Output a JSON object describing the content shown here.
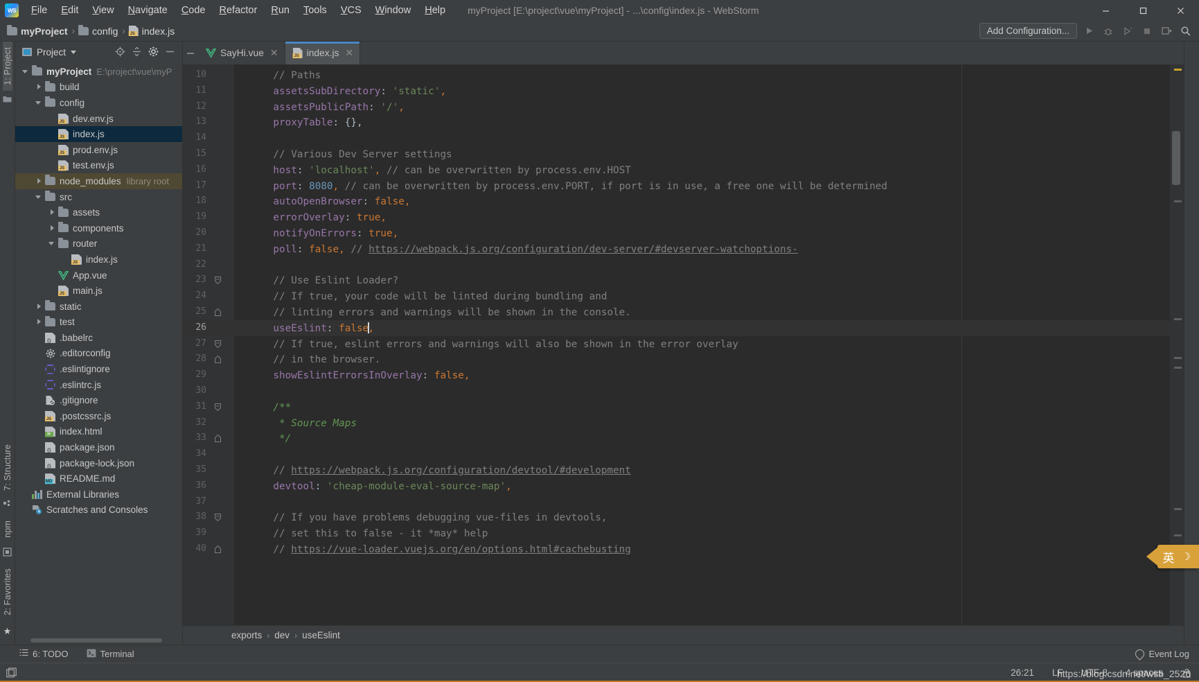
{
  "window": {
    "title": "myProject [E:\\project\\vue\\myProject] - ...\\config\\index.js - WebStorm",
    "minimize": "—",
    "maximize": "☐",
    "close": "✕"
  },
  "menu": {
    "items": [
      "File",
      "Edit",
      "View",
      "Navigate",
      "Code",
      "Refactor",
      "Run",
      "Tools",
      "VCS",
      "Window",
      "Help"
    ]
  },
  "navbar": {
    "breadcrumb": [
      {
        "label": "myProject",
        "icon": "folder-icon",
        "bold": true
      },
      {
        "label": "config",
        "icon": "folder-icon",
        "bold": false
      },
      {
        "label": "index.js",
        "icon": "js-file-icon",
        "bold": false
      }
    ],
    "add_configuration": "Add Configuration...",
    "icons": [
      "run-icon",
      "debug-icon",
      "coverage-icon",
      "stop-icon",
      "search-everywhere-icon",
      "magnifier-icon"
    ]
  },
  "left_strip": {
    "top_label": "1: Project",
    "labels": [
      "7: Structure",
      "npm",
      "2: Favorites"
    ]
  },
  "project_panel": {
    "title": "Project",
    "actions": [
      "locate-icon",
      "collapse-all-icon",
      "gear-icon",
      "hide-icon"
    ],
    "tree": [
      {
        "depth": 0,
        "arrow": "down",
        "icon": "folder",
        "label": "myProject",
        "bold": true,
        "muted": "E:\\project\\vue\\myP"
      },
      {
        "depth": 1,
        "arrow": "right",
        "icon": "folder",
        "label": "build"
      },
      {
        "depth": 1,
        "arrow": "down",
        "icon": "folder",
        "label": "config"
      },
      {
        "depth": 2,
        "arrow": "none",
        "icon": "js",
        "label": "dev.env.js"
      },
      {
        "depth": 2,
        "arrow": "none",
        "icon": "js",
        "label": "index.js",
        "selected": true
      },
      {
        "depth": 2,
        "arrow": "none",
        "icon": "js",
        "label": "prod.env.js"
      },
      {
        "depth": 2,
        "arrow": "none",
        "icon": "js",
        "label": "test.env.js"
      },
      {
        "depth": 1,
        "arrow": "right",
        "icon": "folder",
        "label": "node_modules",
        "libtag": "library root",
        "libroot": true
      },
      {
        "depth": 1,
        "arrow": "down",
        "icon": "folder",
        "label": "src"
      },
      {
        "depth": 2,
        "arrow": "right",
        "icon": "folder",
        "label": "assets"
      },
      {
        "depth": 2,
        "arrow": "right",
        "icon": "folder",
        "label": "components"
      },
      {
        "depth": 2,
        "arrow": "down",
        "icon": "folder",
        "label": "router"
      },
      {
        "depth": 3,
        "arrow": "none",
        "icon": "js",
        "label": "index.js"
      },
      {
        "depth": 2,
        "arrow": "none",
        "icon": "vue",
        "label": "App.vue"
      },
      {
        "depth": 2,
        "arrow": "none",
        "icon": "js",
        "label": "main.js"
      },
      {
        "depth": 1,
        "arrow": "right",
        "icon": "folder",
        "label": "static"
      },
      {
        "depth": 1,
        "arrow": "right",
        "icon": "folder",
        "label": "test"
      },
      {
        "depth": 1,
        "arrow": "none",
        "icon": "babel",
        "label": ".babelrc"
      },
      {
        "depth": 1,
        "arrow": "none",
        "icon": "gear",
        "label": ".editorconfig"
      },
      {
        "depth": 1,
        "arrow": "none",
        "icon": "eslint",
        "label": ".eslintignore"
      },
      {
        "depth": 1,
        "arrow": "none",
        "icon": "eslint",
        "label": ".eslintrc.js"
      },
      {
        "depth": 1,
        "arrow": "none",
        "icon": "gitignore",
        "label": ".gitignore"
      },
      {
        "depth": 1,
        "arrow": "none",
        "icon": "js",
        "label": ".postcssrc.js"
      },
      {
        "depth": 1,
        "arrow": "none",
        "icon": "html",
        "label": "index.html"
      },
      {
        "depth": 1,
        "arrow": "none",
        "icon": "json",
        "label": "package.json"
      },
      {
        "depth": 1,
        "arrow": "none",
        "icon": "json",
        "label": "package-lock.json"
      },
      {
        "depth": 1,
        "arrow": "none",
        "icon": "md",
        "label": "README.md"
      },
      {
        "depth": 0,
        "arrow": "none",
        "icon": "libs",
        "label": "External Libraries"
      },
      {
        "depth": 0,
        "arrow": "none",
        "icon": "scratch",
        "label": "Scratches and Consoles"
      }
    ]
  },
  "editor": {
    "tabs": [
      {
        "label": "SayHi.vue",
        "icon": "vue-file-icon",
        "active": false
      },
      {
        "label": "index.js",
        "icon": "js-file-icon",
        "active": true
      }
    ],
    "first_line": 10,
    "current_line": 26,
    "lines": [
      {
        "n": 10,
        "fold": "",
        "tokens": [
          {
            "t": "    // Paths",
            "c": "c-comment"
          }
        ]
      },
      {
        "n": 11,
        "fold": "",
        "tokens": [
          {
            "t": "    assetsSubDirectory",
            "c": "c-key"
          },
          {
            "t": ": ",
            "c": "c-punc"
          },
          {
            "t": "'static'",
            "c": "c-str"
          },
          {
            "t": ",",
            "c": "c-comma"
          }
        ]
      },
      {
        "n": 12,
        "fold": "",
        "tokens": [
          {
            "t": "    assetsPublicPath",
            "c": "c-key"
          },
          {
            "t": ": ",
            "c": "c-punc"
          },
          {
            "t": "'/'",
            "c": "c-str"
          },
          {
            "t": ",",
            "c": "c-comma"
          }
        ]
      },
      {
        "n": 13,
        "fold": "",
        "tokens": [
          {
            "t": "    proxyTable",
            "c": "c-key"
          },
          {
            "t": ": {},",
            "c": "c-punc"
          }
        ]
      },
      {
        "n": 14,
        "fold": "",
        "tokens": []
      },
      {
        "n": 15,
        "fold": "",
        "tokens": [
          {
            "t": "    // Various Dev Server settings",
            "c": "c-comment"
          }
        ]
      },
      {
        "n": 16,
        "fold": "",
        "tokens": [
          {
            "t": "    host",
            "c": "c-key"
          },
          {
            "t": ": ",
            "c": "c-punc"
          },
          {
            "t": "'localhost'",
            "c": "c-str"
          },
          {
            "t": ",",
            "c": "c-comma"
          },
          {
            "t": " // can be overwritten by process.env.HOST",
            "c": "c-comment"
          }
        ]
      },
      {
        "n": 17,
        "fold": "",
        "tokens": [
          {
            "t": "    port",
            "c": "c-key"
          },
          {
            "t": ": ",
            "c": "c-punc"
          },
          {
            "t": "8080",
            "c": "c-num"
          },
          {
            "t": ",",
            "c": "c-comma"
          },
          {
            "t": " // can be overwritten by process.env.PORT, if port is in use, a free one will be determined",
            "c": "c-comment"
          }
        ]
      },
      {
        "n": 18,
        "fold": "",
        "tokens": [
          {
            "t": "    autoOpenBrowser",
            "c": "c-key"
          },
          {
            "t": ": ",
            "c": "c-punc"
          },
          {
            "t": "false",
            "c": "c-kw"
          },
          {
            "t": ",",
            "c": "c-comma"
          }
        ]
      },
      {
        "n": 19,
        "fold": "",
        "tokens": [
          {
            "t": "    errorOverlay",
            "c": "c-key"
          },
          {
            "t": ": ",
            "c": "c-punc"
          },
          {
            "t": "true",
            "c": "c-kw"
          },
          {
            "t": ",",
            "c": "c-comma"
          }
        ]
      },
      {
        "n": 20,
        "fold": "",
        "tokens": [
          {
            "t": "    notifyOnErrors",
            "c": "c-key"
          },
          {
            "t": ": ",
            "c": "c-punc"
          },
          {
            "t": "true",
            "c": "c-kw"
          },
          {
            "t": ",",
            "c": "c-comma"
          }
        ]
      },
      {
        "n": 21,
        "fold": "",
        "tokens": [
          {
            "t": "    poll",
            "c": "c-key"
          },
          {
            "t": ": ",
            "c": "c-punc"
          },
          {
            "t": "false",
            "c": "c-kw"
          },
          {
            "t": ",",
            "c": "c-comma"
          },
          {
            "t": " // ",
            "c": "c-comment"
          },
          {
            "t": "https://webpack.js.org/configuration/dev-server/#devserver-watchoptions-",
            "c": "c-link"
          }
        ]
      },
      {
        "n": 22,
        "fold": "",
        "tokens": []
      },
      {
        "n": 23,
        "fold": "start",
        "tokens": [
          {
            "t": "    // Use Eslint Loader?",
            "c": "c-comment"
          }
        ]
      },
      {
        "n": 24,
        "fold": "",
        "tokens": [
          {
            "t": "    // If true, your code will be linted during bundling and",
            "c": "c-comment"
          }
        ]
      },
      {
        "n": 25,
        "fold": "end",
        "tokens": [
          {
            "t": "    // linting errors and warnings will be shown in the console.",
            "c": "c-comment"
          }
        ]
      },
      {
        "n": 26,
        "fold": "",
        "current": true,
        "tokens": [
          {
            "t": "    useEslint",
            "c": "c-key"
          },
          {
            "t": ": ",
            "c": "c-punc"
          },
          {
            "t": "false",
            "c": "c-kw"
          },
          {
            "t": "|",
            "c": "caret"
          },
          {
            "t": ",",
            "c": "c-comma"
          }
        ]
      },
      {
        "n": 27,
        "fold": "start",
        "tokens": [
          {
            "t": "    // If true, eslint errors and warnings will also be shown in the error overlay",
            "c": "c-comment"
          }
        ]
      },
      {
        "n": 28,
        "fold": "end",
        "tokens": [
          {
            "t": "    // in the browser.",
            "c": "c-comment"
          }
        ]
      },
      {
        "n": 29,
        "fold": "",
        "tokens": [
          {
            "t": "    showEslintErrorsInOverlay",
            "c": "c-key"
          },
          {
            "t": ": ",
            "c": "c-punc"
          },
          {
            "t": "false",
            "c": "c-kw"
          },
          {
            "t": ",",
            "c": "c-comma"
          }
        ]
      },
      {
        "n": 30,
        "fold": "",
        "tokens": []
      },
      {
        "n": 31,
        "fold": "start",
        "tokens": [
          {
            "t": "    /**",
            "c": "c-doc"
          }
        ]
      },
      {
        "n": 32,
        "fold": "",
        "tokens": [
          {
            "t": "     * Source Maps",
            "c": "c-doc"
          }
        ]
      },
      {
        "n": 33,
        "fold": "end",
        "tokens": [
          {
            "t": "     */",
            "c": "c-doc"
          }
        ]
      },
      {
        "n": 34,
        "fold": "",
        "tokens": []
      },
      {
        "n": 35,
        "fold": "",
        "tokens": [
          {
            "t": "    // ",
            "c": "c-comment"
          },
          {
            "t": "https://webpack.js.org/configuration/devtool/#development",
            "c": "c-link"
          }
        ]
      },
      {
        "n": 36,
        "fold": "",
        "tokens": [
          {
            "t": "    devtool",
            "c": "c-key"
          },
          {
            "t": ": ",
            "c": "c-punc"
          },
          {
            "t": "'cheap-module-eval-source-map'",
            "c": "c-str"
          },
          {
            "t": ",",
            "c": "c-comma"
          }
        ]
      },
      {
        "n": 37,
        "fold": "",
        "tokens": []
      },
      {
        "n": 38,
        "fold": "start",
        "tokens": [
          {
            "t": "    // If you have problems debugging vue-files in devtools,",
            "c": "c-comment"
          }
        ]
      },
      {
        "n": 39,
        "fold": "",
        "tokens": [
          {
            "t": "    // set this to false - it *may* help",
            "c": "c-comment"
          }
        ]
      },
      {
        "n": 40,
        "fold": "end",
        "tokens": [
          {
            "t": "    // ",
            "c": "c-comment"
          },
          {
            "t": "https://vue-loader.vuejs.org/en/options.html#cachebusting",
            "c": "c-link"
          }
        ]
      }
    ],
    "breadcrumb": [
      "exports",
      "dev",
      "useEslint"
    ]
  },
  "right_strip": {
    "labels": []
  },
  "tool_window_bar": {
    "items": [
      {
        "label": "6: TODO",
        "icon": "todo-icon"
      },
      {
        "label": "Terminal",
        "icon": "terminal-icon"
      }
    ],
    "event_log": "Event Log"
  },
  "status_bar": {
    "caret_position": "26:21",
    "line_separator": "LF",
    "encoding": "UTF-8",
    "indent": "4 spaces",
    "lock_icon": "lock-icon"
  },
  "ime_popup": {
    "label": "英",
    "moon": "☽"
  },
  "watermark": {
    "text": "https://blog.csdn.net/wsb_2526"
  },
  "colors": {
    "accent_tab": "#4a88c7",
    "selection": "#0d293e",
    "library_root": "#4f4833",
    "keyword": "#cc7832",
    "string": "#6a8759",
    "property": "#9876aa",
    "number": "#6897bb",
    "comment": "#808080",
    "doc_comment": "#629755",
    "ime_bg": "#d8a13a"
  }
}
